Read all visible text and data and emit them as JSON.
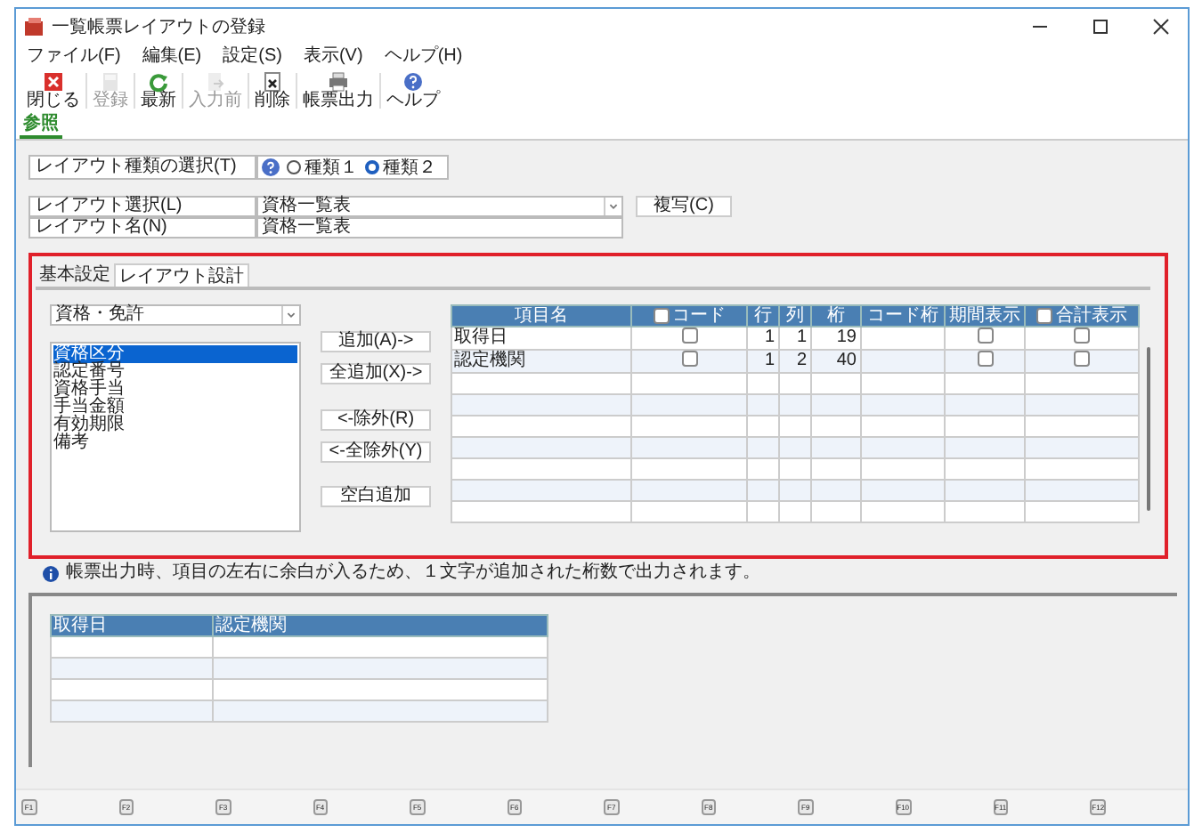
{
  "window": {
    "title": "一覧帳票レイアウトの登録"
  },
  "menu": [
    "ファイル(F)",
    "編集(E)",
    "設定(S)",
    "表示(V)",
    "ヘルプ(H)"
  ],
  "toolbar": [
    {
      "kind": "close",
      "label": "閉じる",
      "disabled": false
    },
    {
      "kind": "save",
      "label": "登録",
      "disabled": true
    },
    {
      "kind": "refresh",
      "label": "最新",
      "disabled": false
    },
    {
      "kind": "back",
      "label": "入力前",
      "disabled": true
    },
    {
      "kind": "delete",
      "label": "削除",
      "disabled": false
    },
    {
      "kind": "print",
      "label": "帳票出力",
      "disabled": false
    },
    {
      "kind": "help",
      "label": "ヘルプ",
      "disabled": false
    }
  ],
  "view_tab": {
    "label": "参照"
  },
  "layout_type": {
    "label": "レイアウト種類の選択(T)",
    "options": [
      {
        "label": "種類１",
        "selected": false
      },
      {
        "label": "種類２",
        "selected": true
      }
    ]
  },
  "layout_select": {
    "label": "レイアウト選択(L)",
    "value": "資格一覧表"
  },
  "layout_name": {
    "label": "レイアウト名(N)",
    "value": "資格一覧表"
  },
  "copy_button": "複写(C)",
  "design": {
    "highlighted": true,
    "tabs": [
      {
        "label": "基本設定",
        "selected": false
      },
      {
        "label": "レイアウト設計",
        "selected": true
      }
    ],
    "category": "資格・免許",
    "items": [
      {
        "label": "資格区分",
        "selected": true
      },
      {
        "label": "認定番号",
        "selected": false
      },
      {
        "label": "資格手当",
        "selected": false
      },
      {
        "label": "手当金額",
        "selected": false
      },
      {
        "label": "有効期限",
        "selected": false
      },
      {
        "label": "備考",
        "selected": false
      }
    ],
    "buttons": [
      "追加(A)->",
      "全追加(X)->",
      "<-除外(R)",
      "<-全除外(Y)",
      "空白追加"
    ],
    "grid": {
      "columns": [
        {
          "label": "項目名",
          "checkbox": false
        },
        {
          "label": "コード",
          "checkbox": true,
          "checked": false
        },
        {
          "label": "行",
          "checkbox": false
        },
        {
          "label": "列",
          "checkbox": false
        },
        {
          "label": "桁",
          "checkbox": false
        },
        {
          "label": "コード桁",
          "checkbox": false
        },
        {
          "label": "期間表示",
          "checkbox": false
        },
        {
          "label": "合計表示",
          "checkbox": true,
          "checked": false
        }
      ],
      "rows": [
        {
          "name": "取得日",
          "code": false,
          "row": "1",
          "col": "1",
          "digits": "19",
          "period": false,
          "total": false
        },
        {
          "name": "認定機関",
          "code": false,
          "row": "1",
          "col": "2",
          "digits": "40",
          "period": false,
          "total": false
        }
      ]
    }
  },
  "note": "帳票出力時、項目の左右に余白が入るため、１文字が追加された桁数で出力されます。",
  "preview": {
    "columns": [
      "取得日",
      "認定機関"
    ]
  },
  "function_keys": [
    "F1",
    "F2",
    "F3",
    "F4",
    "F5",
    "F6",
    "F7",
    "F8",
    "F9",
    "F10",
    "F11",
    "F12"
  ]
}
